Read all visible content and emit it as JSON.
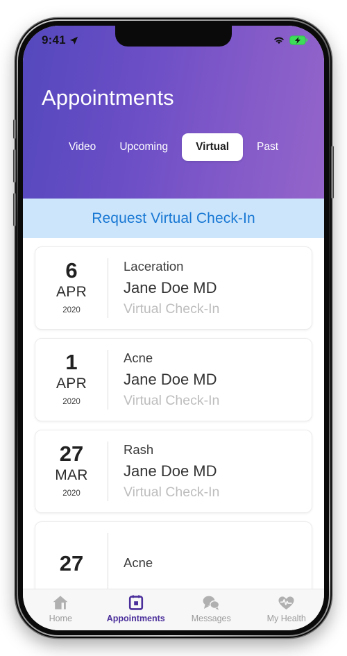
{
  "status_bar": {
    "time": "9:41",
    "location_icon": "location-arrow-icon",
    "wifi_icon": "wifi-icon",
    "battery_icon": "battery-charging-icon",
    "battery_color": "#3ddc59"
  },
  "header": {
    "title": "Appointments",
    "gradient_start": "#5448bd",
    "gradient_end": "#9465ca",
    "tabs": [
      {
        "label": "Video",
        "active": false
      },
      {
        "label": "Upcoming",
        "active": false
      },
      {
        "label": "Virtual",
        "active": true
      },
      {
        "label": "Past",
        "active": false
      }
    ]
  },
  "request_banner": {
    "label": "Request Virtual Check-In",
    "background": "#cde5fa",
    "text_color": "#1878d4"
  },
  "appointments": [
    {
      "day": "6",
      "month": "APR",
      "year": "2020",
      "reason": "Laceration",
      "doctor": "Jane Doe MD",
      "type": "Virtual Check-In"
    },
    {
      "day": "1",
      "month": "APR",
      "year": "2020",
      "reason": "Acne",
      "doctor": "Jane Doe MD",
      "type": "Virtual Check-In"
    },
    {
      "day": "27",
      "month": "MAR",
      "year": "2020",
      "reason": "Rash",
      "doctor": "Jane Doe MD",
      "type": "Virtual Check-In"
    },
    {
      "day": "27",
      "month": "",
      "year": "",
      "reason": "Acne",
      "doctor": "",
      "type": ""
    }
  ],
  "bottom_nav": {
    "active_color": "#4b2f9b",
    "inactive_color": "#9b9b9b",
    "items": [
      {
        "label": "Home",
        "icon": "home-icon",
        "active": false
      },
      {
        "label": "Appointments",
        "icon": "calendar-icon",
        "active": true
      },
      {
        "label": "Messages",
        "icon": "chat-bubbles-icon",
        "active": false
      },
      {
        "label": "My Health",
        "icon": "heart-pulse-icon",
        "active": false
      }
    ]
  }
}
